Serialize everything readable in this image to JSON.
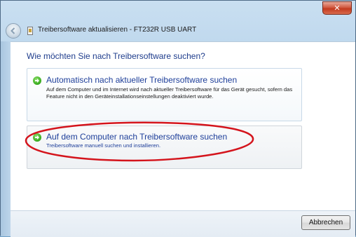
{
  "window": {
    "title": "Treibersoftware aktualisieren - FT232R USB UART",
    "close_symbol": "✕"
  },
  "heading": "Wie möchten Sie nach Treibersoftware suchen?",
  "options": [
    {
      "title": "Automatisch nach aktueller Treibersoftware suchen",
      "description": "Auf dem Computer und im Internet wird nach aktueller Treibersoftware für das Gerät gesucht, sofern das Feature nicht in den Geräteinstallationseinstellungen deaktiviert wurde."
    },
    {
      "title": "Auf dem Computer nach Treibersoftware suchen",
      "description": "Treibersoftware manuell suchen und installieren."
    }
  ],
  "footer": {
    "cancel_label": "Abbrechen"
  },
  "colors": {
    "link_blue": "#1f3f9a",
    "annotation_red": "#d4141c",
    "arrow_green": "#34a81c"
  },
  "icons": {
    "back": "back-arrow-icon",
    "device": "usb-device-icon",
    "option_arrow": "green-arrow-icon",
    "close": "close-icon"
  }
}
